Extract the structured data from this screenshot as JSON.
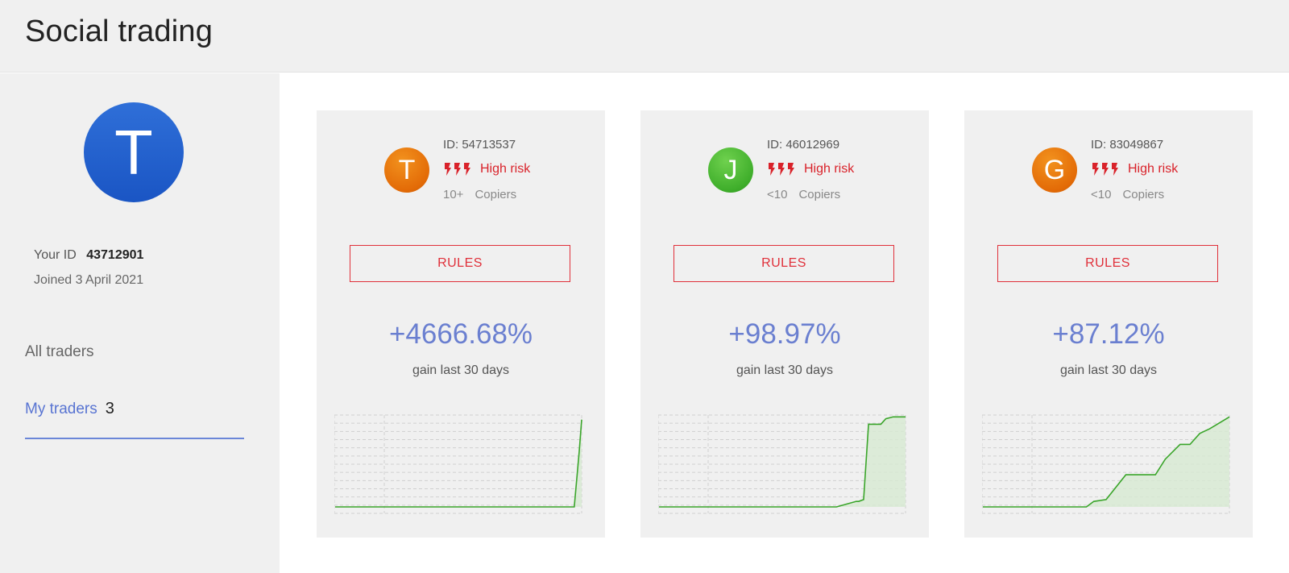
{
  "header": {
    "title": "Social trading"
  },
  "sidebar": {
    "avatar_letter": "T",
    "user_id_label": "Your ID",
    "user_id": "43712901",
    "joined": "Joined 3 April 2021",
    "nav": {
      "all_traders": "All traders",
      "my_traders": "My traders",
      "my_traders_count": "3"
    }
  },
  "traders": [
    {
      "letter": "T",
      "avatar_color": "#e8730c",
      "id": "ID: 54713537",
      "risk": "High risk",
      "copiers_count": "10+",
      "copiers_label": "Copiers",
      "rules": "RULES",
      "gain": "+4666.68%",
      "gain_label": "gain last 30 days"
    },
    {
      "letter": "J",
      "avatar_color": "#45b02f",
      "id": "ID: 46012969",
      "risk": "High risk",
      "copiers_count": "<10",
      "copiers_label": "Copiers",
      "rules": "RULES",
      "gain": "+98.97%",
      "gain_label": "gain last 30 days"
    },
    {
      "letter": "G",
      "avatar_color": "#e8730c",
      "id": "ID: 83049867",
      "risk": "High risk",
      "copiers_count": "<10",
      "copiers_label": "Copiers",
      "rules": "RULES",
      "gain": "+87.12%",
      "gain_label": "gain last 30 days"
    }
  ],
  "colors": {
    "risk": "#d9222a",
    "gain": "#6a7fd0",
    "chart_line": "#3aa52a",
    "chart_fill": "#d7ead2",
    "nav_active": "#5874d2"
  },
  "chart_data": [
    {
      "type": "area",
      "x": [
        0,
        0.2,
        0.4,
        0.6,
        0.8,
        0.97,
        0.99,
        1.0
      ],
      "values": [
        0,
        0,
        0,
        0,
        0,
        0,
        0.6,
        0.95
      ]
    },
    {
      "type": "area",
      "x": [
        0,
        0.2,
        0.4,
        0.6,
        0.7,
        0.72,
        0.8,
        0.81,
        0.83,
        0.85,
        0.9,
        0.92,
        0.95,
        1.0
      ],
      "values": [
        0,
        0,
        0,
        0,
        0,
        0,
        0.06,
        0.06,
        0.08,
        0.9,
        0.9,
        0.96,
        0.98,
        0.98
      ]
    },
    {
      "type": "area",
      "x": [
        0,
        0.2,
        0.4,
        0.42,
        0.45,
        0.5,
        0.58,
        0.6,
        0.66,
        0.7,
        0.74,
        0.8,
        0.84,
        0.88,
        0.92,
        1.0
      ],
      "values": [
        0,
        0,
        0,
        0,
        0.06,
        0.08,
        0.35,
        0.35,
        0.35,
        0.35,
        0.52,
        0.68,
        0.68,
        0.8,
        0.85,
        0.98
      ]
    }
  ]
}
